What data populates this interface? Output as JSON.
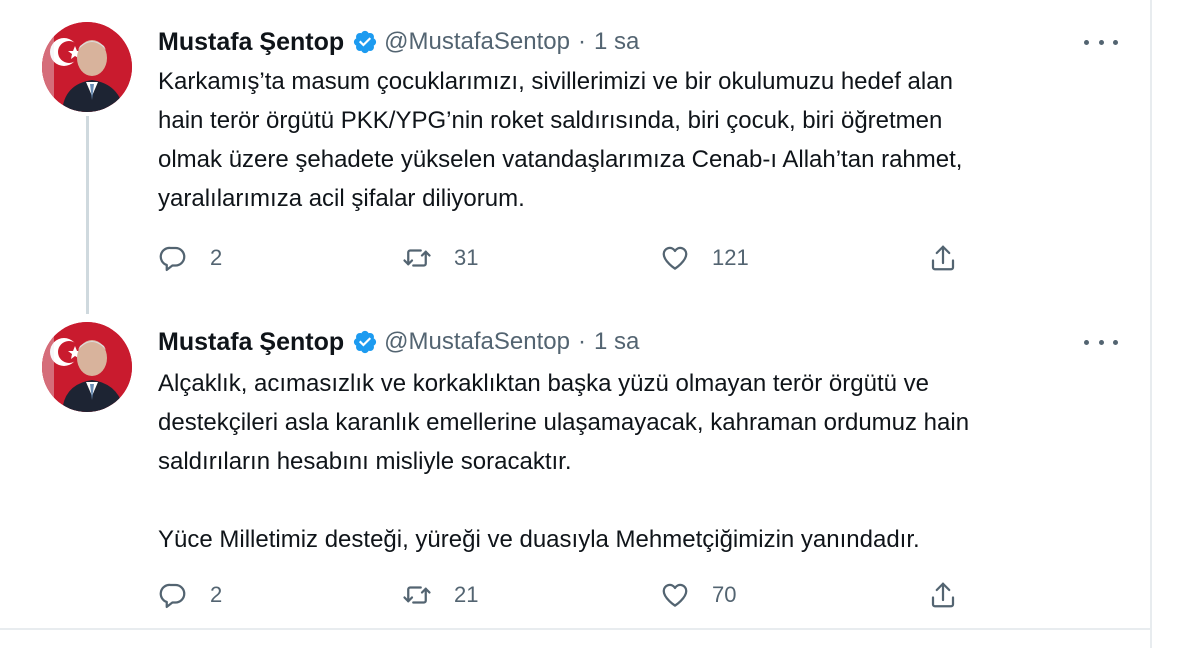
{
  "tweets": [
    {
      "author": {
        "name": "Mustafa Şentop",
        "handle": "@MustafaSentop",
        "verified": true
      },
      "separator": "·",
      "time": "1 sa",
      "text_lines": [
        "Karkamış’ta masum çocuklarımızı, sivillerimizi ve bir okulumuzu hedef alan",
        "hain terör örgütü PKK/YPG’nin roket saldırısında, biri çocuk, biri öğretmen",
        "olmak üzere şehadete yükselen vatandaşlarımıza Cenab-ı Allah’tan rahmet,",
        "yaralılarımıza acil şifalar diliyorum."
      ],
      "stats": {
        "replies": "2",
        "retweets": "31",
        "likes": "121"
      }
    },
    {
      "author": {
        "name": "Mustafa Şentop",
        "handle": "@MustafaSentop",
        "verified": true
      },
      "separator": "·",
      "time": "1 sa",
      "text_lines": [
        "Alçaklık, acımasızlık ve korkaklıktan başka yüzü olmayan terör örgütü ve",
        "destekçileri asla karanlık emellerine ulaşamayacak, kahraman ordumuz hain",
        "saldırıların hesabını misliyle soracaktır."
      ],
      "text_paragraph2": "Yüce Milletimiz desteği, yüreği ve duasıyla Mehmetçiğimizin yanındadır.",
      "stats": {
        "replies": "2",
        "retweets": "21",
        "likes": "70"
      }
    }
  ],
  "icons": {
    "reply": "reply-icon",
    "retweet": "retweet-icon",
    "like": "heart-icon",
    "share": "share-icon",
    "verified": "verified-badge-icon",
    "more": "more-icon"
  },
  "colors": {
    "verified_blue": "#1d9bf0",
    "text_primary": "#0f1419",
    "text_secondary": "#536471",
    "avatar_flag_red": "#c91b2e"
  }
}
